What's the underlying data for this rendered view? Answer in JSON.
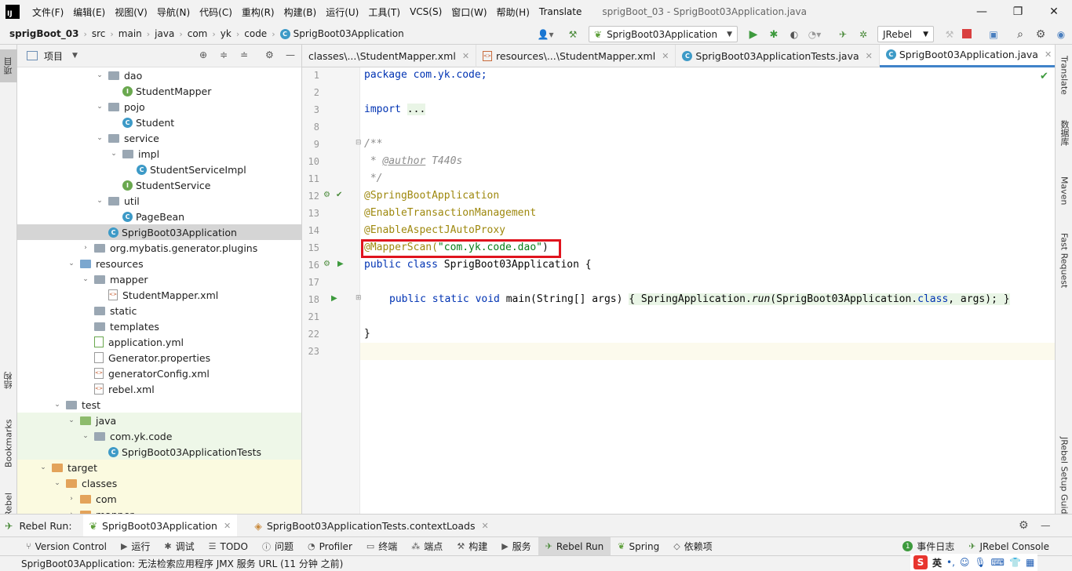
{
  "titlebar": {
    "menu": [
      "文件(F)",
      "编辑(E)",
      "视图(V)",
      "导航(N)",
      "代码(C)",
      "重构(R)",
      "构建(B)",
      "运行(U)",
      "工具(T)",
      "VCS(S)",
      "窗口(W)",
      "帮助(H)",
      "Translate"
    ],
    "window_title": "sprigBoot_03 - SprigBoot03Application.java",
    "logo": "IJ"
  },
  "navbar": {
    "crumbs": [
      "sprigBoot_03",
      "src",
      "main",
      "java",
      "com",
      "yk",
      "code",
      "SprigBoot03Application"
    ],
    "run_config": "SprigBoot03Application",
    "jrebel": "JRebel"
  },
  "project": {
    "title": "项目",
    "rows": [
      {
        "label": "dao",
        "kind": "folder",
        "indent": 1,
        "arrow": "down"
      },
      {
        "label": "StudentMapper",
        "kind": "interface",
        "indent": 2
      },
      {
        "label": "pojo",
        "kind": "folder",
        "indent": 1,
        "arrow": "down"
      },
      {
        "label": "Student",
        "kind": "class",
        "indent": 2
      },
      {
        "label": "service",
        "kind": "folder",
        "indent": 1,
        "arrow": "down"
      },
      {
        "label": "impl",
        "kind": "folder",
        "indent": 2,
        "arrow": "down"
      },
      {
        "label": "StudentServiceImpl",
        "kind": "class",
        "indent": 3
      },
      {
        "label": "StudentService",
        "kind": "interface",
        "indent": 2
      },
      {
        "label": "util",
        "kind": "folder",
        "indent": 1,
        "arrow": "down"
      },
      {
        "label": "PageBean",
        "kind": "class",
        "indent": 2
      },
      {
        "label": "SprigBoot03Application",
        "kind": "class-spring",
        "indent": 1,
        "selected": true
      },
      {
        "label": "org.mybatis.generator.plugins",
        "kind": "folder",
        "indent": 0,
        "arrow": "right"
      },
      {
        "label": "resources",
        "kind": "folder-res",
        "indent": -1,
        "arrow": "down"
      },
      {
        "label": "mapper",
        "kind": "folder",
        "indent": 0,
        "arrow": "down"
      },
      {
        "label": "StudentMapper.xml",
        "kind": "xml",
        "indent": 1
      },
      {
        "label": "static",
        "kind": "folder",
        "indent": 0
      },
      {
        "label": "templates",
        "kind": "folder",
        "indent": 0
      },
      {
        "label": "application.yml",
        "kind": "yml",
        "indent": 0
      },
      {
        "label": "Generator.properties",
        "kind": "props",
        "indent": 0
      },
      {
        "label": "generatorConfig.xml",
        "kind": "xml",
        "indent": 0
      },
      {
        "label": "rebel.xml",
        "kind": "xml",
        "indent": 0
      },
      {
        "label": "test",
        "kind": "folder",
        "indent": -2,
        "arrow": "down"
      },
      {
        "label": "java",
        "kind": "folder-green",
        "indent": -1,
        "arrow": "down",
        "bg": "green"
      },
      {
        "label": "com.yk.code",
        "kind": "folder",
        "indent": 0,
        "arrow": "down",
        "bg": "green"
      },
      {
        "label": "SprigBoot03ApplicationTests",
        "kind": "class",
        "indent": 1,
        "bg": "green"
      },
      {
        "label": "target",
        "kind": "folder-orange",
        "indent": -3,
        "arrow": "down",
        "bg": "yellow"
      },
      {
        "label": "classes",
        "kind": "folder-orange",
        "indent": -2,
        "arrow": "down",
        "bg": "yellow"
      },
      {
        "label": "com",
        "kind": "folder-orange",
        "indent": -1,
        "arrow": "right",
        "bg": "yellow"
      },
      {
        "label": "mapper",
        "kind": "folder-orange",
        "indent": -1,
        "arrow": "right",
        "bg": "yellow"
      }
    ]
  },
  "tabs": [
    {
      "label": "classes\\...\\StudentMapper.xml",
      "icon": "xml"
    },
    {
      "label": "resources\\...\\StudentMapper.xml",
      "icon": "xml"
    },
    {
      "label": "SprigBoot03ApplicationTests.java",
      "icon": "class"
    },
    {
      "label": "SprigBoot03Application.java",
      "icon": "class",
      "active": true
    }
  ],
  "editor": {
    "line_numbers": [
      "1",
      "2",
      "3",
      "8",
      "9",
      "10",
      "11",
      "12",
      "13",
      "14",
      "15",
      "16",
      "17",
      "18",
      "21",
      "22",
      "23"
    ],
    "lines": {
      "l1": "package com.yk.code;",
      "l3_kw": "import",
      "l3_fold": "...",
      "l9": "/**",
      "l10_prefix": " * ",
      "l10_tag": "@author",
      "l10_val": " T440s",
      "l11": " */",
      "l12": "@SpringBootApplication",
      "l13": "@EnableTransactionManagement",
      "l14": "@EnableAspectJAutoProxy",
      "l15_ann": "@MapperScan(",
      "l15_str": "\"com.yk.code.dao\"",
      "l15_end": ")",
      "l16_kw": "public class",
      "l16_rest": " SprigBoot03Application {",
      "l18_kw": "public static void",
      "l18_name": " main(String[] args) ",
      "l18_body_a": "{ SpringApplication.",
      "l18_run": "run",
      "l18_body_b": "(SprigBoot03Application.",
      "l18_class": "class",
      "l18_body_c": ", args); }",
      "l22": "}"
    }
  },
  "right_tabs": [
    "Translate",
    "数据库",
    "Maven",
    "Fast Request",
    "JRebel Setup Guide"
  ],
  "left_tabs": [
    "项目",
    "结构",
    "Bookmarks",
    "JRebel"
  ],
  "run_bar": {
    "label": "Rebel Run:",
    "tabs": [
      "SprigBoot03Application",
      "SprigBoot03ApplicationTests.contextLoads"
    ]
  },
  "tool_bar": [
    "Version Control",
    "运行",
    "调试",
    "TODO",
    "问题",
    "Profiler",
    "终端",
    "端点",
    "构建",
    "服务",
    "Rebel Run",
    "Spring",
    "依赖项",
    "事件日志",
    "JRebel Console"
  ],
  "status": "SprigBoot03Application: 无法检索应用程序 JMX 服务 URL (11 分钟 之前)",
  "ime": {
    "logo": "S",
    "lang": "英"
  }
}
